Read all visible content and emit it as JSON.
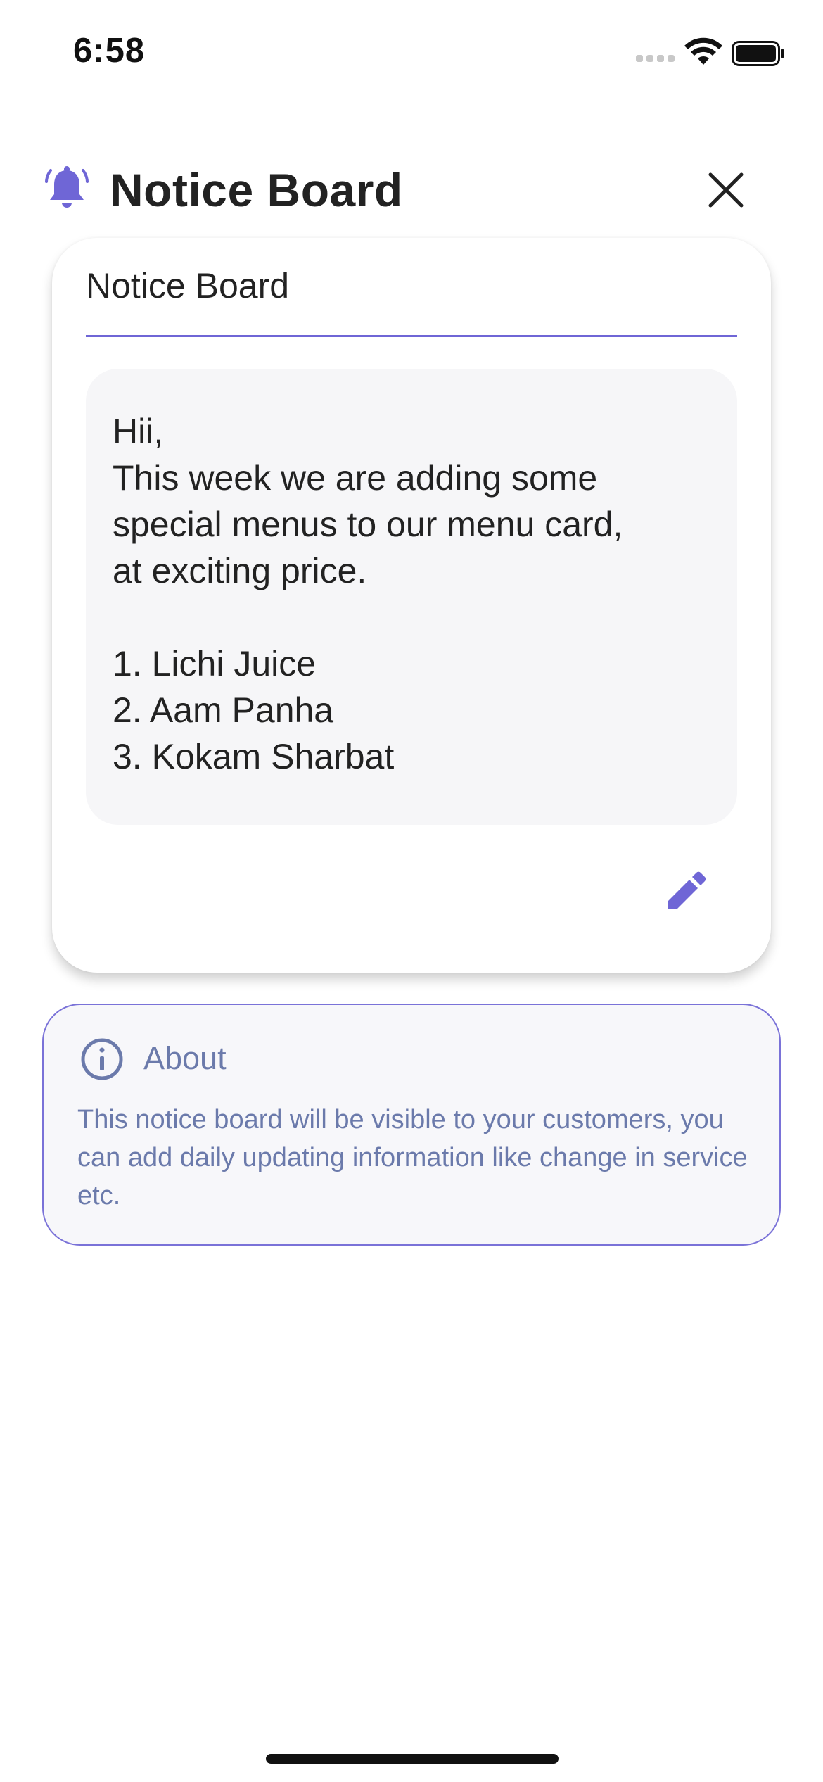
{
  "status_bar": {
    "time": "6:58"
  },
  "header": {
    "title": "Notice Board",
    "bell_icon": "bell-icon",
    "close_icon": "close-icon"
  },
  "notice": {
    "title_value": "Notice Board",
    "message_lines": [
      "Hii,",
      "This week we are adding some",
      "special menus to our menu card,",
      "at exciting price.",
      "",
      "1. Lichi Juice",
      "2. Aam Panha",
      "3. Kokam Sharbat"
    ],
    "edit_icon": "pencil-icon"
  },
  "about": {
    "title": "About",
    "text": "This notice board will be visible to your customers, you can add daily updating information like change in service etc.",
    "icon": "info-icon"
  },
  "colors": {
    "accent": "#6f66d6",
    "about_text": "#6b7aab",
    "about_border": "#7a72d8",
    "message_bg": "#f6f6f8"
  }
}
